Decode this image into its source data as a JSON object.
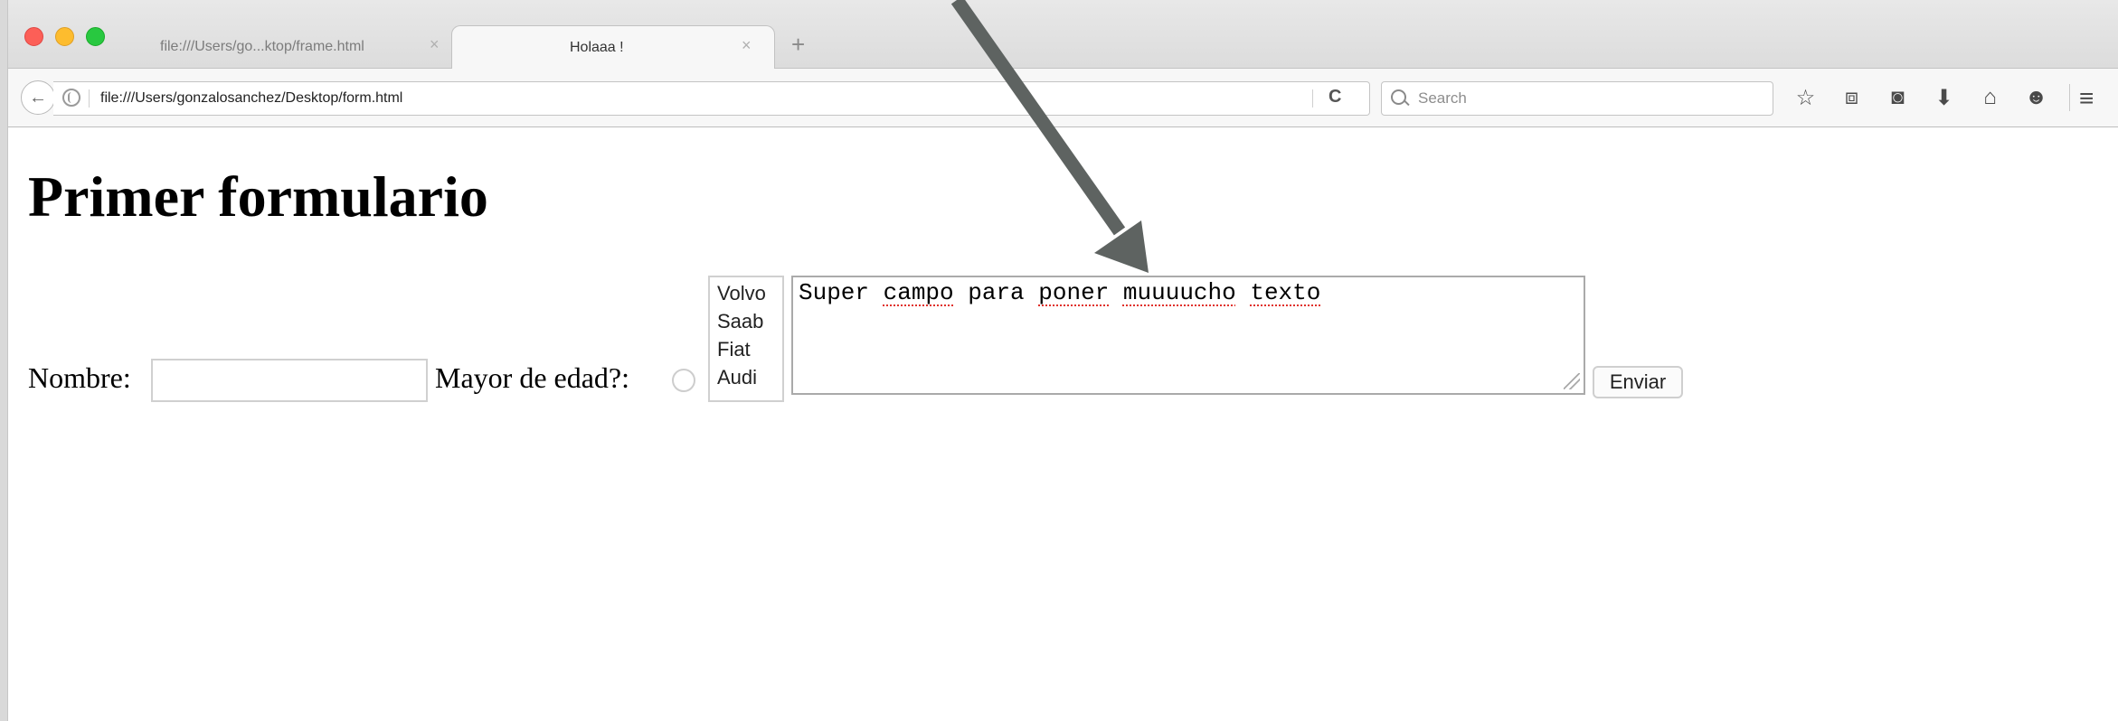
{
  "browser": {
    "tabs": [
      {
        "label": "file:///Users/go...ktop/frame.html",
        "close": "×"
      },
      {
        "label": "Holaaa !",
        "close": "×"
      }
    ],
    "new_tab": "+",
    "url": "file:///Users/gonzalosanchez/Desktop/form.html",
    "reload": "C",
    "search_placeholder": "Search",
    "toolbar_icons": [
      "star-icon",
      "clipboard-icon",
      "pocket-icon",
      "download-icon",
      "home-icon",
      "chat-icon"
    ],
    "toolbar_glyphs": [
      "☆",
      "⧈",
      "◙",
      "⬇",
      "⌂",
      "☻"
    ],
    "menu": "≡"
  },
  "page": {
    "title": "Primer formulario",
    "name_label": "Nombre:",
    "name_value": "",
    "adult_label": "Mayor de edad?:",
    "cars": [
      "Volvo",
      "Saab",
      "Fiat",
      "Audi"
    ],
    "textarea_words": [
      "Super",
      "campo",
      "para",
      "poner",
      "muuuucho",
      "texto"
    ],
    "submit_label": "Enviar"
  },
  "colors": {
    "arrow": "#5e6361",
    "spell_underline": "#e0302a"
  }
}
